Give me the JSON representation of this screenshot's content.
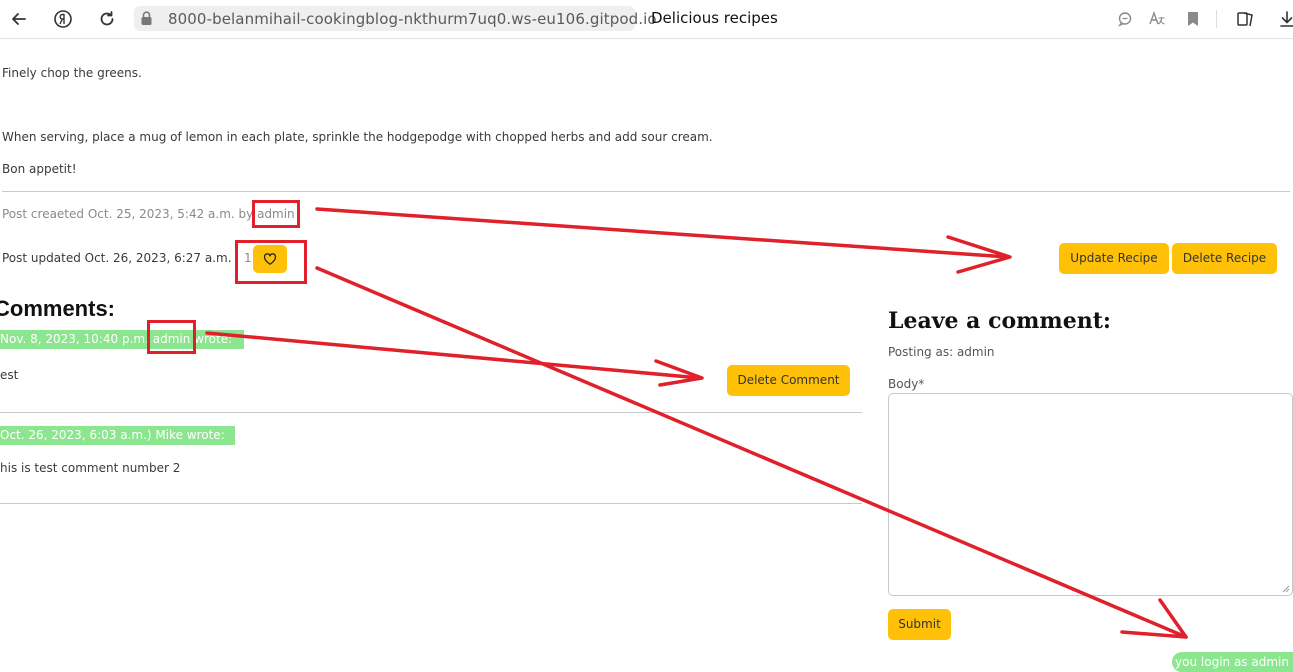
{
  "browser": {
    "url": "8000-belanmihail-cookingblog-nkthurm7uq0.ws-eu106.gitpod.io",
    "tab_title": "Delicious recipes"
  },
  "recipe": {
    "step_chop": "Finely chop the greens.",
    "step_serve": "When serving, place a mug of lemon in each plate, sprinkle the hodgepodge with chopped herbs and add sour cream.",
    "closing": "Bon appetit!"
  },
  "post_meta": {
    "created_prefix": "Post creaeted Oct. 25, 2023, 5:42 a.m. by ",
    "author": "admin",
    "updated": "Post updated Oct. 26, 2023, 6:27 a.m.",
    "like_count": "1"
  },
  "actions": {
    "update_label": "Update Recipe",
    "delete_label": "Delete Recipe"
  },
  "comments": {
    "heading": "Comments:",
    "items": [
      {
        "date": "Nov. 8, 2023, 10:40 p.m.",
        "author": "admin",
        "suffix": "wrote:",
        "body": "est",
        "delete_label": "Delete Comment"
      },
      {
        "meta": "Oct. 26, 2023, 6:03 a.m.) Mike wrote:",
        "body": "his is test comment number 2"
      }
    ]
  },
  "comment_form": {
    "heading": "Leave a comment:",
    "posting_as": "Posting as: admin",
    "body_label": "Body*",
    "submit_label": "Submit"
  },
  "login_badge": {
    "prefix": "you login as ",
    "user": "admin"
  },
  "colors": {
    "accent_yellow": "#ffc107",
    "comment_green": "#8be68f",
    "annotation_red": "#e0202a"
  }
}
